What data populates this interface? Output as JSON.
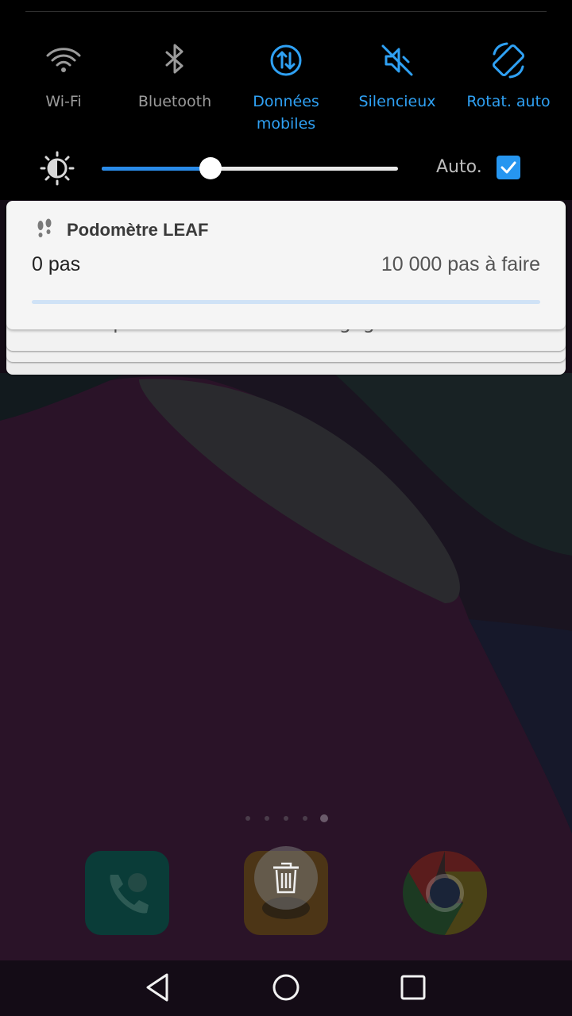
{
  "quick_settings": {
    "tiles": [
      {
        "label": "Wi-Fi",
        "icon": "wifi-icon",
        "active": false
      },
      {
        "label": "Bluetooth",
        "icon": "bluetooth-icon",
        "active": false
      },
      {
        "label_line1": "Données",
        "label_line2": "mobiles",
        "icon": "mobile-data-icon",
        "active": true
      },
      {
        "label": "Silencieux",
        "icon": "mute-icon",
        "active": true
      },
      {
        "label": "Rotat. auto",
        "icon": "auto-rotate-icon",
        "active": true
      }
    ],
    "brightness": {
      "icon": "brightness-icon",
      "level": 0.367,
      "auto_label": "Auto.",
      "auto_checked": true
    },
    "colors": {
      "active": "#2fa1f4",
      "inactive": "#9b9b9b",
      "slider": "#2a8be8"
    }
  },
  "notification": {
    "app_icon": "footprints-icon",
    "app_name": "Podomètre LEAF",
    "steps": "0 pas",
    "goal": "10 000 pas à faire",
    "progress": 0
  },
  "hidden_notification": {
    "text": "Toucher pour désactiver le débogage USB"
  },
  "home_screen": {
    "page_count": 5,
    "current_page": 5,
    "dock": [
      {
        "name": "phone-app-icon"
      },
      {
        "name": "app-icon"
      },
      {
        "name": "chrome-app-icon"
      }
    ],
    "trash_icon": "trash-icon"
  },
  "navigation": {
    "buttons": [
      "back-icon",
      "home-icon",
      "recents-icon"
    ]
  }
}
